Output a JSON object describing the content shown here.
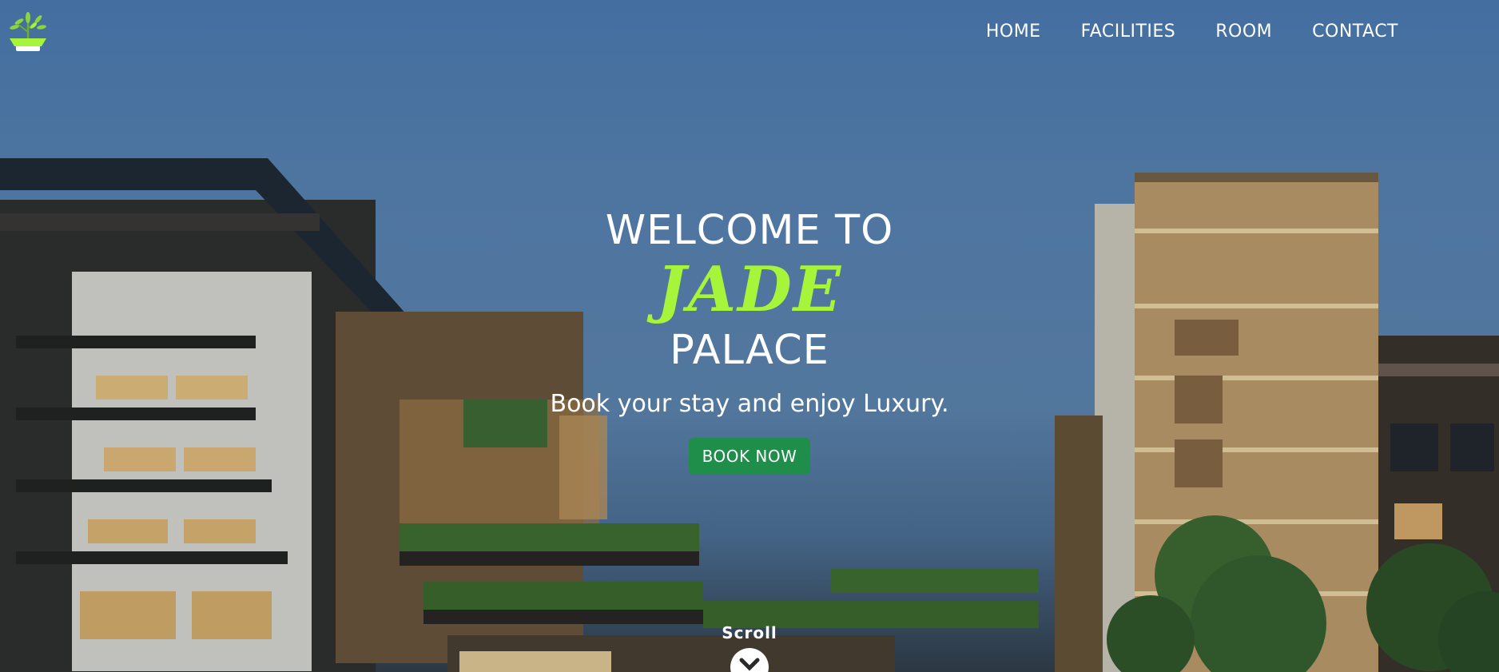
{
  "nav": {
    "items": [
      "HOME",
      "FACILITIES",
      "ROOM",
      "CONTACT"
    ]
  },
  "hero": {
    "welcome": "WELCOME TO",
    "brand": "JADE",
    "palace": "PALACE",
    "tagline": "Book your stay and enjoy Luxury.",
    "cta_label": "BOOK NOW"
  },
  "scroll": {
    "label": "Scroll",
    "icon": "chevron-down-icon"
  },
  "colors": {
    "brand_green": "#a6f53a",
    "button_green": "#1f8e4a"
  }
}
